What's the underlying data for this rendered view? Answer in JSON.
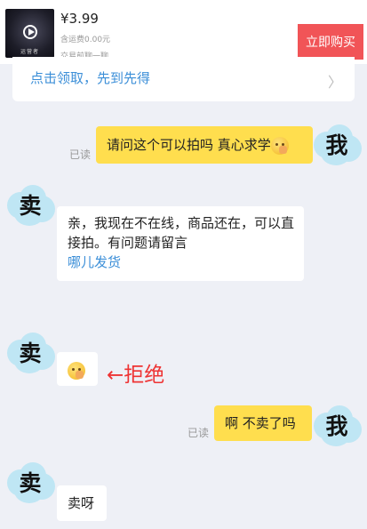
{
  "product": {
    "thumbnail_caption": "运营者",
    "price": "¥3.99",
    "shipping": "含运费0.00元",
    "chat_hint": "交易前聊一聊",
    "buy_label": "立即购买"
  },
  "coupon": {
    "text": "点击领取，先到先得",
    "chevron": "〉"
  },
  "avatars": {
    "me": "我",
    "seller": "卖"
  },
  "messages": {
    "m1_text": "请问这个可以拍吗 真心求学",
    "m1_read": "已读",
    "m2_text": "亲，我现在不在线，商品还在，可以直接拍。有问题请留言",
    "m2_link": "哪儿发货",
    "m3_annotation": "←拒绝",
    "m4_text": "啊 不卖了吗",
    "m4_read": "已读",
    "m5_text": "卖呀"
  },
  "colors": {
    "buy_button": "#f15457",
    "my_bubble": "#ffde4e",
    "link": "#3c8fd8",
    "annotation": "#e33333"
  },
  "icons": [
    "play-icon",
    "chevron-right-icon",
    "thinking-emoji-icon"
  ]
}
